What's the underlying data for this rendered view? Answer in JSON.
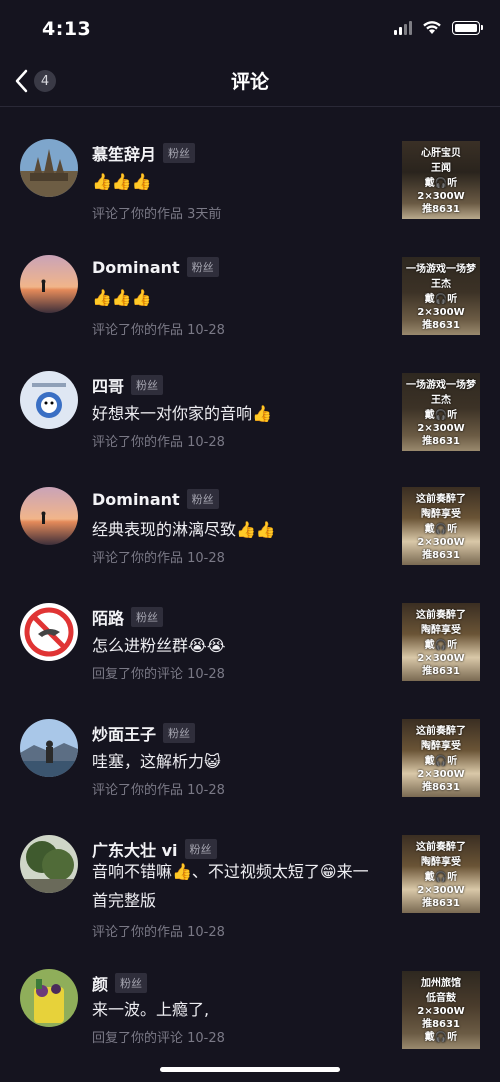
{
  "status": {
    "time": "4:13"
  },
  "nav": {
    "back_count": "4",
    "title": "评论"
  },
  "comments": [
    {
      "name": "慕笙辞月",
      "badge": "粉丝",
      "text": "👍👍👍",
      "meta": "评论了你的作品  3天前",
      "thumb": [
        "心肝宝贝",
        "王闻",
        "戴🎧听",
        "2×300W",
        "推8631"
      ]
    },
    {
      "name": "Dominant",
      "badge": "粉丝",
      "text": "👍👍👍",
      "meta": "评论了你的作品  10-28",
      "thumb": [
        "一场游戏一场梦",
        "王杰",
        "戴🎧听",
        "2×300W",
        "推8631"
      ]
    },
    {
      "name": "四哥",
      "badge": "粉丝",
      "text": "好想来一对你家的音响👍",
      "meta": "评论了你的作品  10-28",
      "thumb": [
        "一场游戏一场梦",
        "王杰",
        "戴🎧听",
        "2×300W",
        "推8631"
      ]
    },
    {
      "name": "Dominant",
      "badge": "粉丝",
      "text": "经典表现的淋漓尽致👍👍",
      "meta": "评论了你的作品  10-28",
      "thumb": [
        "这前奏醉了",
        "陶醉享受",
        "戴🎧听",
        "2×300W",
        "推8631"
      ]
    },
    {
      "name": "陌路",
      "badge": "粉丝",
      "text": "怎么进粉丝群😭😭",
      "meta": "回复了你的评论  10-28",
      "thumb": [
        "这前奏醉了",
        "陶醉享受",
        "戴🎧听",
        "2×300W",
        "推8631"
      ]
    },
    {
      "name": "炒面王子",
      "badge": "粉丝",
      "text": "哇塞，这解析力😺",
      "meta": "评论了你的作品  10-28",
      "thumb": [
        "这前奏醉了",
        "陶醉享受",
        "戴🎧听",
        "2×300W",
        "推8631"
      ]
    },
    {
      "name": "广东大壮 vi",
      "badge": "粉丝",
      "text": "音响不错嘛👍、不过视频太短了😁来一首完整版",
      "meta": "评论了你的作品  10-28",
      "thumb": [
        "这前奏醉了",
        "陶醉享受",
        "戴🎧听",
        "2×300W",
        "推8631"
      ]
    },
    {
      "name": "颜",
      "badge": "粉丝",
      "text": "来一波。上瘾了,",
      "meta": "回复了你的评论  10-28",
      "thumb": [
        "加州旅馆",
        "低音鼓",
        "2×300W",
        "推8631",
        "戴🎧听"
      ]
    }
  ],
  "colors": {
    "background": "#15141f",
    "secondary_text": "#7a7986",
    "badge_bg": "#2f2e3b"
  }
}
